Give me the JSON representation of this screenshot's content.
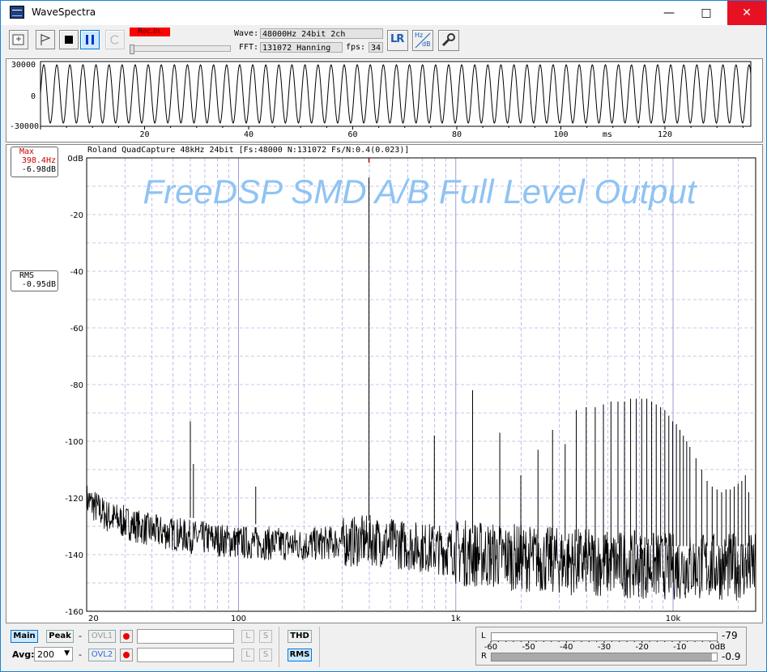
{
  "window": {
    "title": "WaveSpectra"
  },
  "toolbar": {
    "rec_label": "Rec.In.",
    "wave_label": "Wave:",
    "wave_value": "48000Hz 24bit 2ch",
    "fft_label": "FFT:",
    "fft_value": "131072 Hanning",
    "fps_label": "fps:",
    "fps_value": "34",
    "lr_label": "LR",
    "hz_label": "Hz",
    "db_label": "dB"
  },
  "wave": {
    "y_ticks": [
      "30000",
      "0",
      "-30000"
    ],
    "x_ticks": [
      "20",
      "40",
      "60",
      "80",
      "100",
      "120"
    ],
    "x_unit": "ms"
  },
  "spectrum": {
    "header": "Roland QuadCapture 48kHz 24bit  [Fs:48000 N:131072 Fs/N:0.4(0.023)]",
    "overlay_title": "FreeDSP SMD A/B Full Level Output",
    "max_label": "Max",
    "max_freq": "398.4Hz",
    "max_level": "-6.98dB",
    "rms_label": "RMS",
    "rms_level": "-0.95dB",
    "y_ticks": [
      "0dB",
      "-20",
      "-40",
      "-60",
      "-80",
      "-100",
      "-120",
      "-140",
      "-160"
    ],
    "x_ticks": [
      "20",
      "100",
      "1k",
      "10k"
    ],
    "colors": {
      "grid": "#9090d8",
      "trace": "#000000",
      "overlay": "#8fc3f3",
      "max": "#cc0000"
    }
  },
  "chart_data": {
    "type": "line",
    "title": "",
    "xlabel": "",
    "ylabel": "",
    "x_scale": "log",
    "xlim": [
      20,
      24000
    ],
    "ylim": [
      -160,
      0
    ],
    "peaks": [
      {
        "x": 60,
        "y": -93
      },
      {
        "x": 62,
        "y": -108
      },
      {
        "x": 120,
        "y": -116
      },
      {
        "x": 398.4,
        "y": -6.98
      },
      {
        "x": 796.8,
        "y": -98
      },
      {
        "x": 1195,
        "y": -82
      },
      {
        "x": 1594,
        "y": -97
      },
      {
        "x": 1992,
        "y": -112
      },
      {
        "x": 2390,
        "y": -103
      },
      {
        "x": 2789,
        "y": -96
      },
      {
        "x": 3187,
        "y": -101
      },
      {
        "x": 3586,
        "y": -89
      },
      {
        "x": 3984,
        "y": -88
      },
      {
        "x": 4383,
        "y": -88
      },
      {
        "x": 4781,
        "y": -87
      },
      {
        "x": 5180,
        "y": -86
      },
      {
        "x": 5578,
        "y": -86
      },
      {
        "x": 5977,
        "y": -86
      },
      {
        "x": 6375,
        "y": -85
      },
      {
        "x": 6773,
        "y": -85
      },
      {
        "x": 7172,
        "y": -85
      },
      {
        "x": 7570,
        "y": -85
      },
      {
        "x": 7969,
        "y": -86
      },
      {
        "x": 8367,
        "y": -87
      },
      {
        "x": 8766,
        "y": -88
      },
      {
        "x": 9164,
        "y": -89
      },
      {
        "x": 9562,
        "y": -91
      },
      {
        "x": 9961,
        "y": -93
      },
      {
        "x": 10359,
        "y": -94
      },
      {
        "x": 10758,
        "y": -96
      },
      {
        "x": 11156,
        "y": -98
      },
      {
        "x": 11555,
        "y": -100
      },
      {
        "x": 11953,
        "y": -102
      },
      {
        "x": 12750,
        "y": -106
      },
      {
        "x": 13547,
        "y": -110
      },
      {
        "x": 14344,
        "y": -114
      },
      {
        "x": 15141,
        "y": -116
      },
      {
        "x": 15938,
        "y": -117
      },
      {
        "x": 16734,
        "y": -118
      },
      {
        "x": 17531,
        "y": -117
      },
      {
        "x": 18328,
        "y": -117
      },
      {
        "x": 19125,
        "y": -116
      },
      {
        "x": 19922,
        "y": -115
      },
      {
        "x": 20719,
        "y": -114
      },
      {
        "x": 21516,
        "y": -112
      },
      {
        "x": 22312,
        "y": -118
      }
    ],
    "noise_floor": [
      {
        "x": 20,
        "y": -120
      },
      {
        "x": 25,
        "y": -126
      },
      {
        "x": 30,
        "y": -128
      },
      {
        "x": 40,
        "y": -131
      },
      {
        "x": 60,
        "y": -133
      },
      {
        "x": 100,
        "y": -135
      },
      {
        "x": 200,
        "y": -136
      },
      {
        "x": 398,
        "y": -134
      },
      {
        "x": 1000,
        "y": -138
      },
      {
        "x": 3000,
        "y": -141
      },
      {
        "x": 10000,
        "y": -143
      },
      {
        "x": 24000,
        "y": -143
      }
    ]
  },
  "bottom": {
    "main_label": "Main",
    "peak_label": "Peak",
    "ovl1_label": "OVL1",
    "ovl2_label": "OVL2",
    "dash": "-",
    "avg_label": "Avg:",
    "avg_value": "200",
    "l_label": "L",
    "s_label": "S",
    "thd_label": "THD",
    "rms_label": "RMS",
    "meter_l": "L",
    "meter_r": "R",
    "meter_l_value": "-79",
    "meter_r_value": "-0.9",
    "meter_r_fraction": 0.98,
    "meter_scale": [
      "-60",
      "-50",
      "-40",
      "-30",
      "-20",
      "-10",
      "0dB"
    ]
  }
}
